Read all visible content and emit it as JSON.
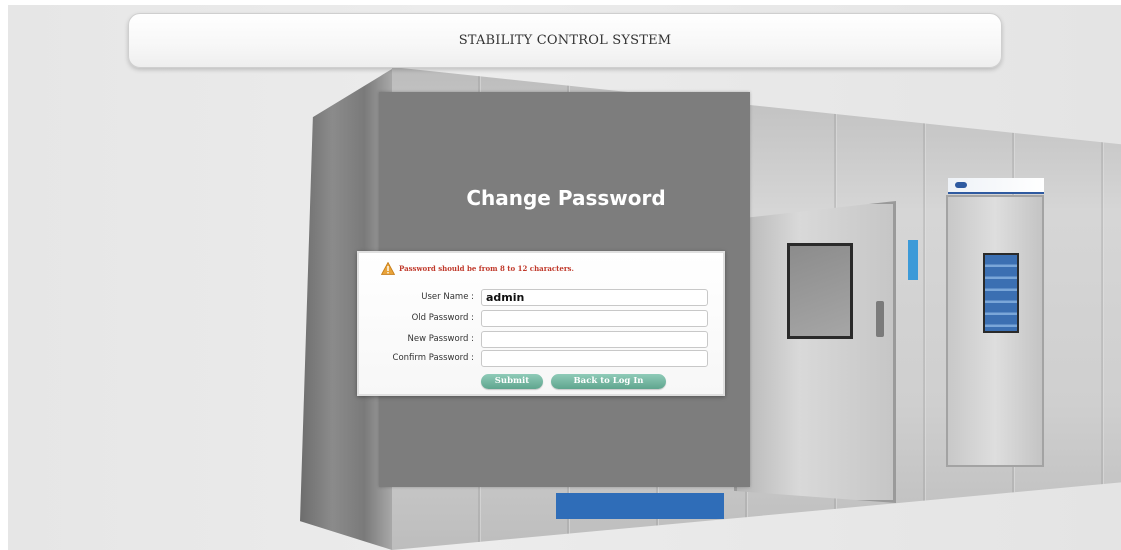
{
  "header": {
    "title": "STABILITY CONTROL SYSTEM"
  },
  "panel": {
    "title": "Change Password"
  },
  "form": {
    "warning": "Password should be from 8 to 12 characters.",
    "username_label": "User Name :",
    "username_value": "admin",
    "old_password_label": "Old Password :",
    "old_password_value": "",
    "new_password_label": "New Password :",
    "new_password_value": "",
    "confirm_password_label": "Confirm Password :",
    "confirm_password_value": "",
    "submit_label": "Submit",
    "back_label": "Back to Log In"
  },
  "colors": {
    "panel_gray": "#7d7d7d",
    "warning_red": "#c0392b",
    "button_green": "#5fa58e",
    "warning_icon_orange": "#e8a33a"
  },
  "icons": {
    "warning": "warning-triangle-icon"
  }
}
